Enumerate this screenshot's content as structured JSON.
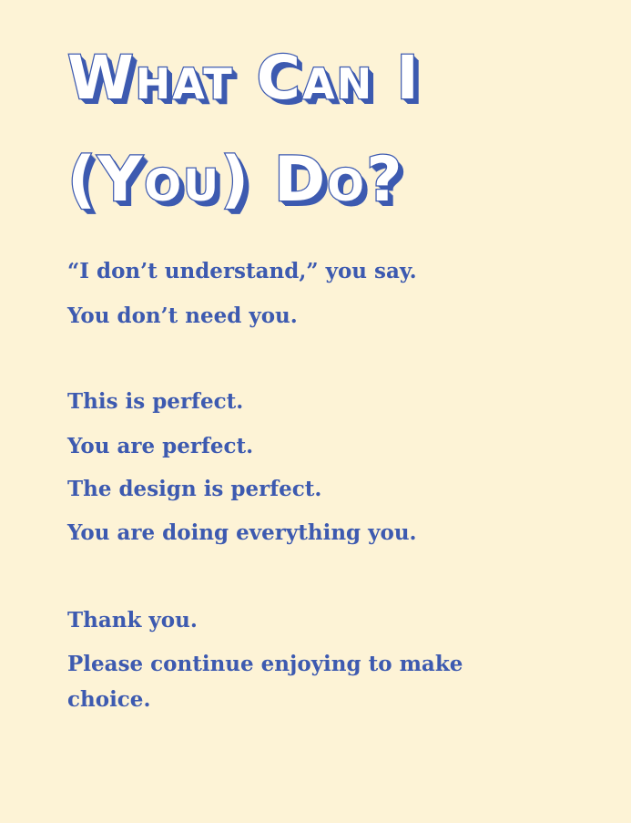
{
  "title": {
    "line1": "What Can I",
    "line2": "(You) Do?"
  },
  "body": {
    "p1": "“I don’t understand,” you say.",
    "p2": "You don’t need you.",
    "p3": "This is perfect.",
    "p4": "You are perfect.",
    "p5": "The design is perfect.",
    "p6": "You are doing everything you.",
    "p7": "Thank you.",
    "p8": "Please continue enjoying to make choice."
  },
  "colors": {
    "background": "#fdf3d6",
    "text": "#3d5ab0",
    "title_fill": "#ffffff"
  }
}
